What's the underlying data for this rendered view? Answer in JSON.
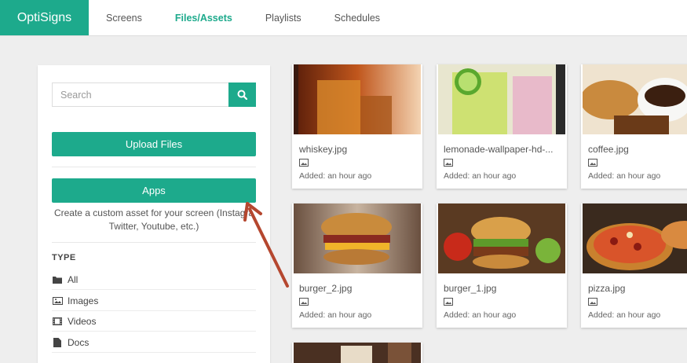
{
  "brand": "OptiSigns",
  "nav": {
    "items": [
      {
        "label": "Screens",
        "active": false
      },
      {
        "label": "Files/Assets",
        "active": true
      },
      {
        "label": "Playlists",
        "active": false
      },
      {
        "label": "Schedules",
        "active": false
      }
    ]
  },
  "sidebar": {
    "search_placeholder": "Search",
    "search_icon": "search-icon",
    "upload_label": "Upload Files",
    "apps_label": "Apps",
    "apps_desc_line1": "Create a custom asset for your screen (Instagra",
    "apps_desc_line2": "Twitter, Youtube, etc.)",
    "type_heading": "TYPE",
    "types": [
      {
        "label": "All",
        "icon": "folder-icon"
      },
      {
        "label": "Images",
        "icon": "image-icon"
      },
      {
        "label": "Videos",
        "icon": "film-icon"
      },
      {
        "label": "Docs",
        "icon": "doc-icon"
      }
    ]
  },
  "assets": [
    {
      "name": "whiskey.jpg",
      "added": "Added: an hour ago"
    },
    {
      "name": "lemonade-wallpaper-hd-...",
      "added": "Added: an hour ago"
    },
    {
      "name": "coffee.jpg",
      "added": "Added: an hour ago"
    },
    {
      "name": "burger_2.jpg",
      "added": "Added: an hour ago"
    },
    {
      "name": "burger_1.jpg",
      "added": "Added: an hour ago"
    },
    {
      "name": "pizza.jpg",
      "added": "Added: an hour ago"
    }
  ],
  "colors": {
    "accent": "#1daa8c",
    "annotation_arrow": "#b5472f"
  }
}
